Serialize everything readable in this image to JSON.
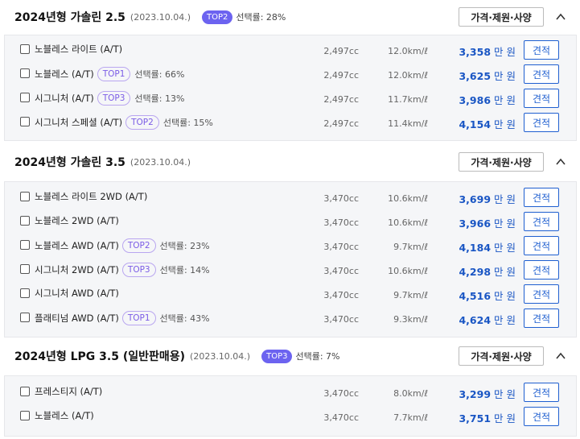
{
  "spec_button_label": "가격·제원·사양",
  "estimate_label": "견적",
  "price_unit": "만 원",
  "pick_prefix": "선택률:",
  "sections": [
    {
      "title": "2024년형 가솔린 2.5",
      "date": "(2023.10.04.)",
      "badge": "TOP2",
      "rate": "선택률: 28%",
      "trims": [
        {
          "name": "노블레스 라이트 (A/T)",
          "top": "",
          "pick": "",
          "cc": "2,497cc",
          "eff": "12.0km/ℓ",
          "price": "3,358"
        },
        {
          "name": "노블레스 (A/T)",
          "top": "TOP1",
          "pick": "선택률: 66%",
          "cc": "2,497cc",
          "eff": "12.0km/ℓ",
          "price": "3,625"
        },
        {
          "name": "시그니처 (A/T)",
          "top": "TOP3",
          "pick": "선택률: 13%",
          "cc": "2,497cc",
          "eff": "11.7km/ℓ",
          "price": "3,986"
        },
        {
          "name": "시그니처 스페셜 (A/T)",
          "top": "TOP2",
          "pick": "선택률: 15%",
          "cc": "2,497cc",
          "eff": "11.4km/ℓ",
          "price": "4,154"
        }
      ]
    },
    {
      "title": "2024년형 가솔린 3.5",
      "date": "(2023.10.04.)",
      "badge": "",
      "rate": "",
      "trims": [
        {
          "name": "노블레스 라이트 2WD (A/T)",
          "top": "",
          "pick": "",
          "cc": "3,470cc",
          "eff": "10.6km/ℓ",
          "price": "3,699"
        },
        {
          "name": "노블레스 2WD (A/T)",
          "top": "",
          "pick": "",
          "cc": "3,470cc",
          "eff": "10.6km/ℓ",
          "price": "3,966"
        },
        {
          "name": "노블레스 AWD (A/T)",
          "top": "TOP2",
          "pick": "선택률: 23%",
          "cc": "3,470cc",
          "eff": "9.7km/ℓ",
          "price": "4,184"
        },
        {
          "name": "시그니처 2WD (A/T)",
          "top": "TOP3",
          "pick": "선택률: 14%",
          "cc": "3,470cc",
          "eff": "10.6km/ℓ",
          "price": "4,298"
        },
        {
          "name": "시그니처 AWD (A/T)",
          "top": "",
          "pick": "",
          "cc": "3,470cc",
          "eff": "9.7km/ℓ",
          "price": "4,516"
        },
        {
          "name": "플래티넘 AWD (A/T)",
          "top": "TOP1",
          "pick": "선택률: 43%",
          "cc": "3,470cc",
          "eff": "9.3km/ℓ",
          "price": "4,624"
        }
      ]
    },
    {
      "title": "2024년형 LPG 3.5 (일반판매용)",
      "date": "(2023.10.04.)",
      "badge": "TOP3",
      "rate": "선택률: 7%",
      "trims": [
        {
          "name": "프레스티지 (A/T)",
          "top": "",
          "pick": "",
          "cc": "3,470cc",
          "eff": "8.0km/ℓ",
          "price": "3,299"
        },
        {
          "name": "노블레스 (A/T)",
          "top": "",
          "pick": "",
          "cc": "3,470cc",
          "eff": "7.7km/ℓ",
          "price": "3,751"
        }
      ]
    }
  ]
}
